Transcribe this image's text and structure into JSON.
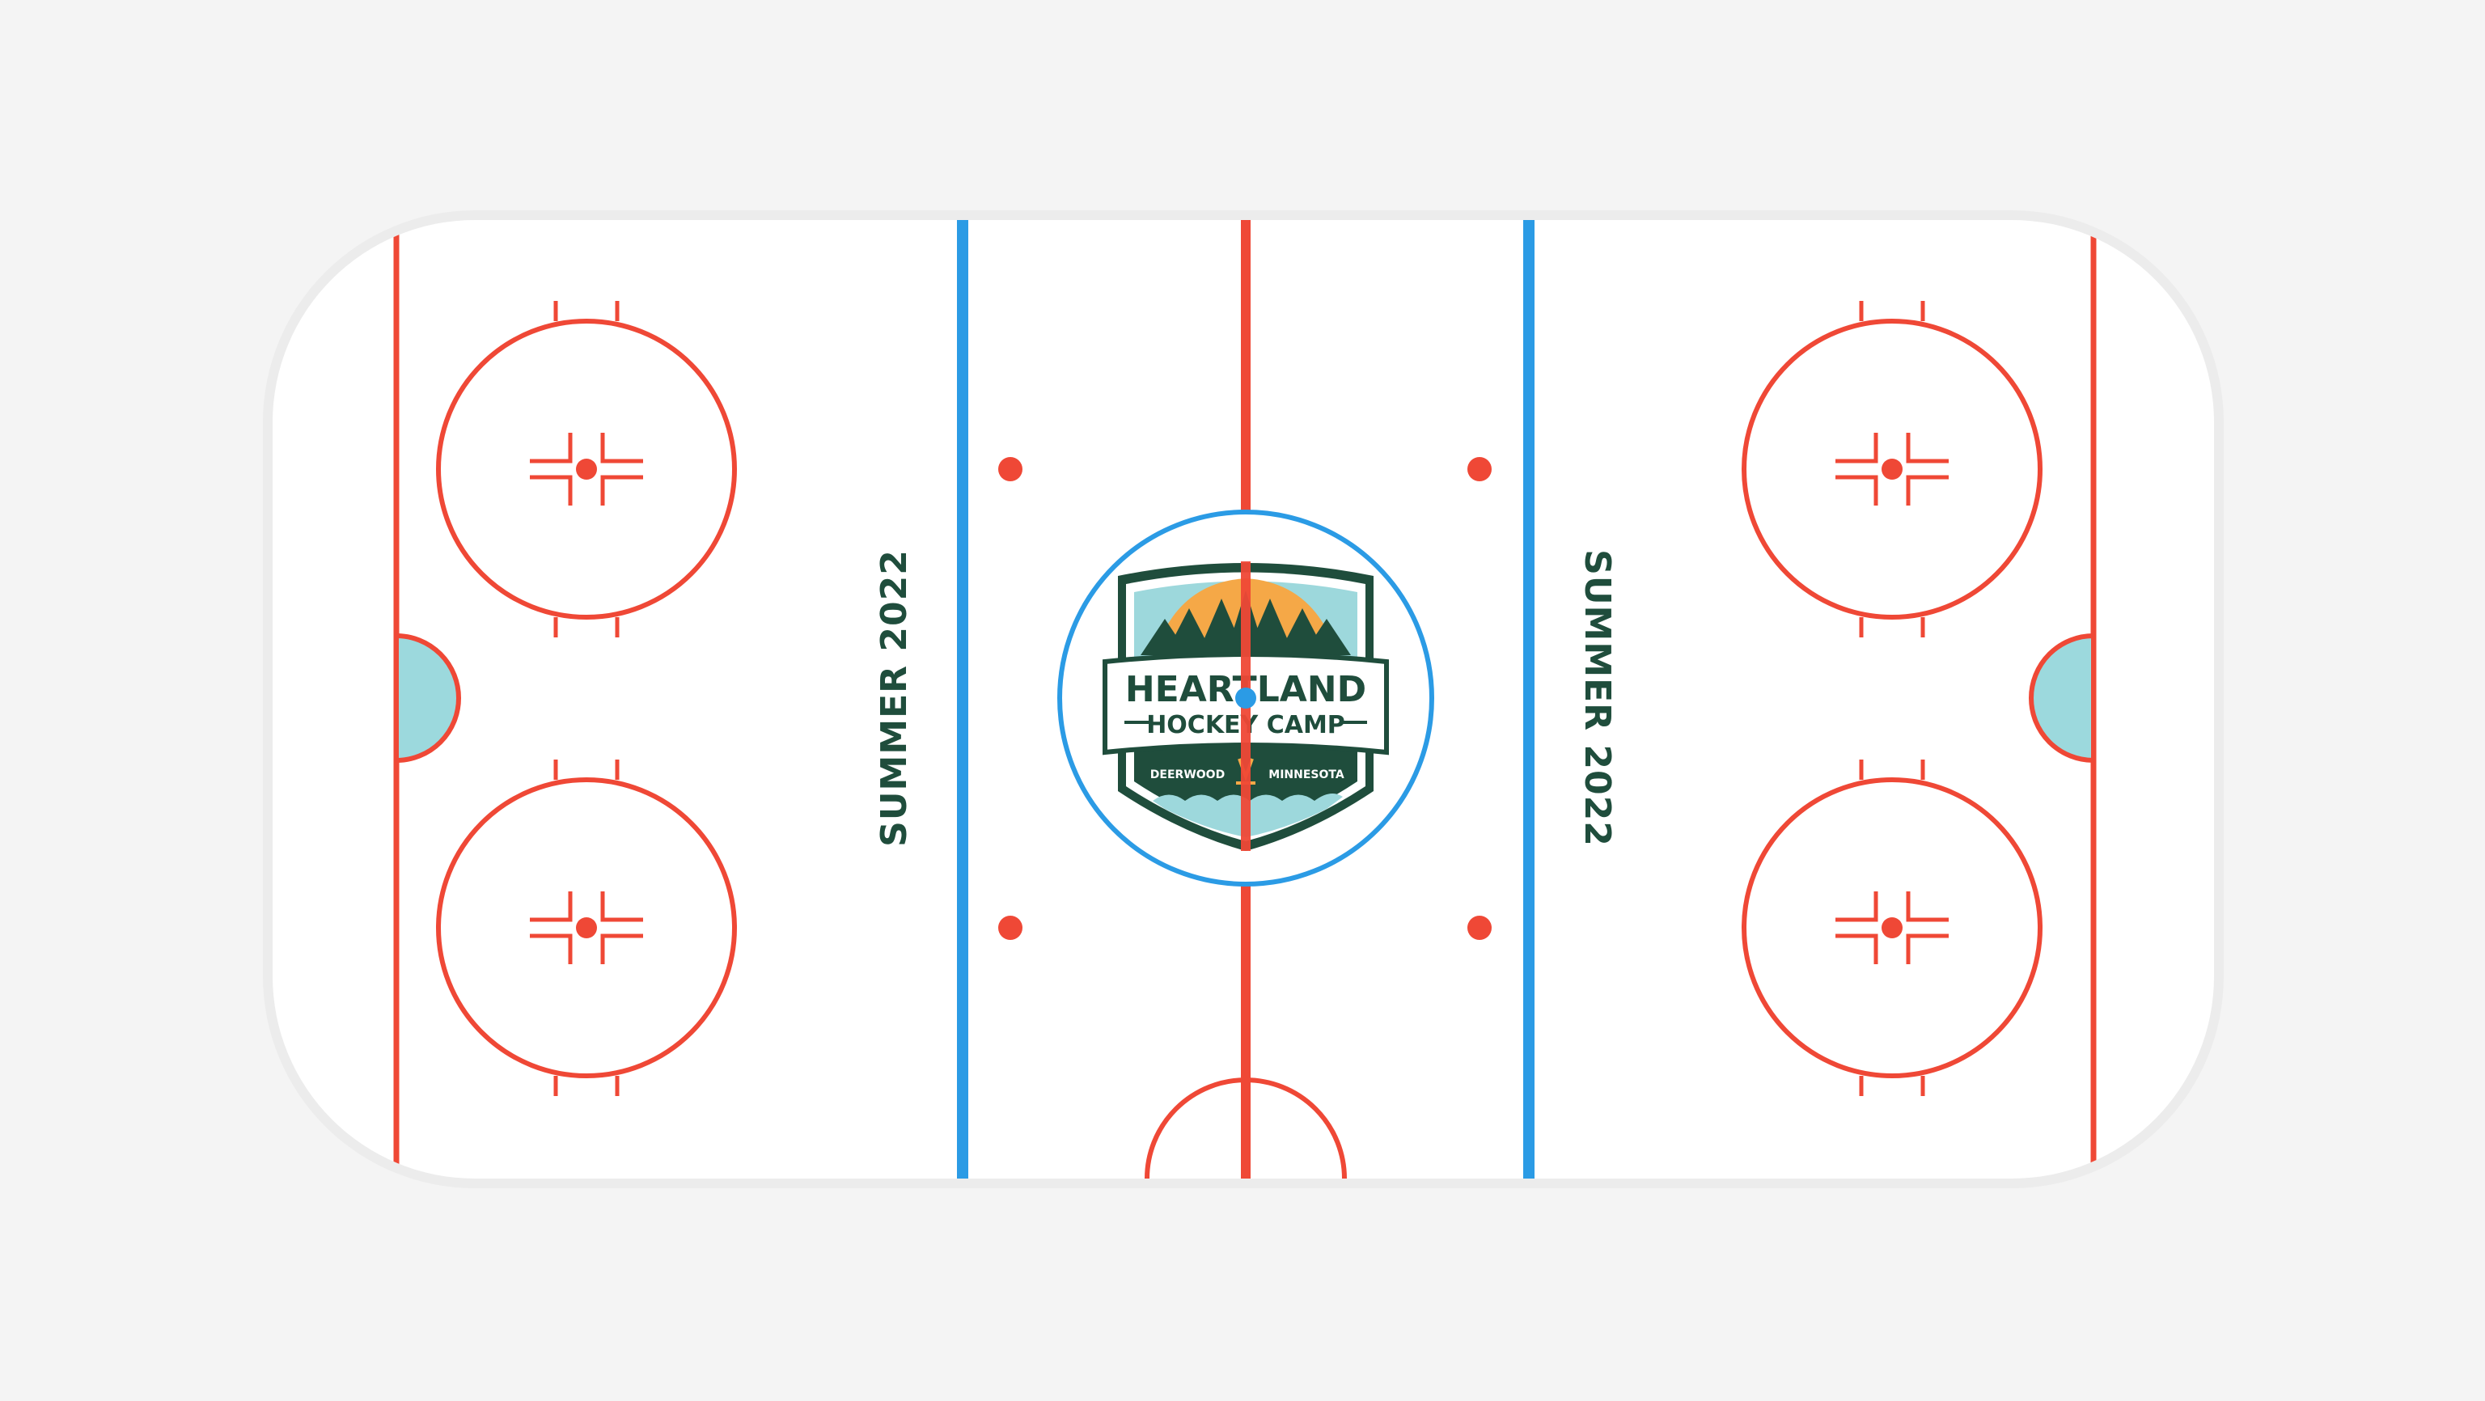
{
  "rink": {
    "left_text": "SUMMER 2022",
    "right_text": "SUMMER 2022"
  },
  "logo": {
    "line1": "HEARTLAND",
    "line2": "HOCKEY CAMP",
    "location_left": "DEERWOOD",
    "location_right": "MINNESOTA"
  },
  "colors": {
    "background": "#f4f4f4",
    "boards": "#ececec",
    "ice": "#ffffff",
    "red_line": "#ef4836",
    "blue_line": "#2b9be5",
    "crease": "#9cd9dd",
    "logo_green": "#1f4d3c",
    "logo_orange": "#f5a847",
    "logo_sky": "#9dd8dc"
  }
}
